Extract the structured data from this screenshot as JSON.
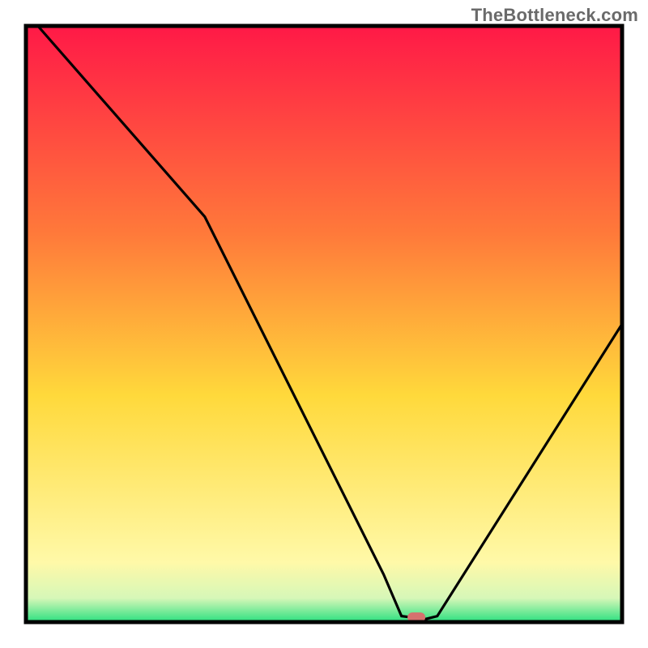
{
  "watermark": "TheBottleneck.com",
  "chart_data": {
    "type": "line",
    "title": "",
    "xlabel": "",
    "ylabel": "",
    "xlim": [
      0,
      100
    ],
    "ylim": [
      0,
      100
    ],
    "grid": false,
    "curve_points": [
      {
        "x": 2,
        "y": 100
      },
      {
        "x": 30,
        "y": 68
      },
      {
        "x": 60,
        "y": 8
      },
      {
        "x": 63,
        "y": 1
      },
      {
        "x": 67,
        "y": 0.5
      },
      {
        "x": 69,
        "y": 1
      },
      {
        "x": 100,
        "y": 50
      }
    ],
    "marker": {
      "x": 65.5,
      "y": 0.8,
      "color": "#d6726e"
    },
    "background_gradient": {
      "top_color": "#ff1947",
      "mid_color": "#ffd93b",
      "near_bottom_color": "#fff9a8",
      "bottom_color": "#2ae07f"
    },
    "frame_color": "#000000",
    "line_color": "#000000"
  }
}
